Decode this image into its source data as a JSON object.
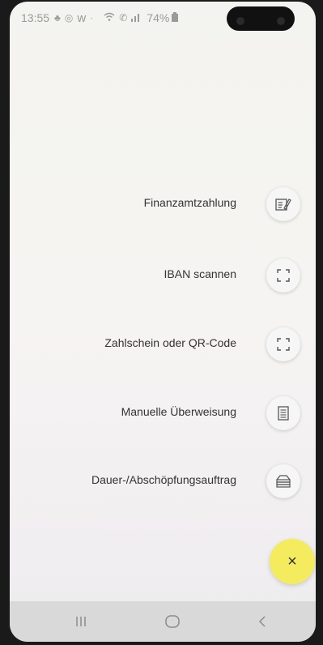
{
  "status_bar": {
    "time": "13:55",
    "battery": "74%",
    "icons": [
      "notification-icon",
      "whatsapp-icon",
      "w-app-icon",
      "dot-icon",
      "wifi-icon",
      "call-icon",
      "signal-icon",
      "battery-icon"
    ]
  },
  "menu": {
    "items": [
      {
        "label": "Finanzamtzahlung",
        "icon": "tax-form-icon"
      },
      {
        "label": "IBAN scannen",
        "icon": "scan-frame-icon"
      },
      {
        "label": "Zahlschein oder QR-Code",
        "icon": "scan-frame-icon"
      },
      {
        "label": "Manuelle Überweisung",
        "icon": "document-icon"
      },
      {
        "label": "Dauer-/Abschöpfungsauftrag",
        "icon": "stack-icon"
      }
    ]
  },
  "fab": {
    "label": "×",
    "color": "#f4ec5e"
  },
  "nav": {
    "icons": [
      "recent-apps-icon",
      "home-icon",
      "back-icon"
    ]
  }
}
